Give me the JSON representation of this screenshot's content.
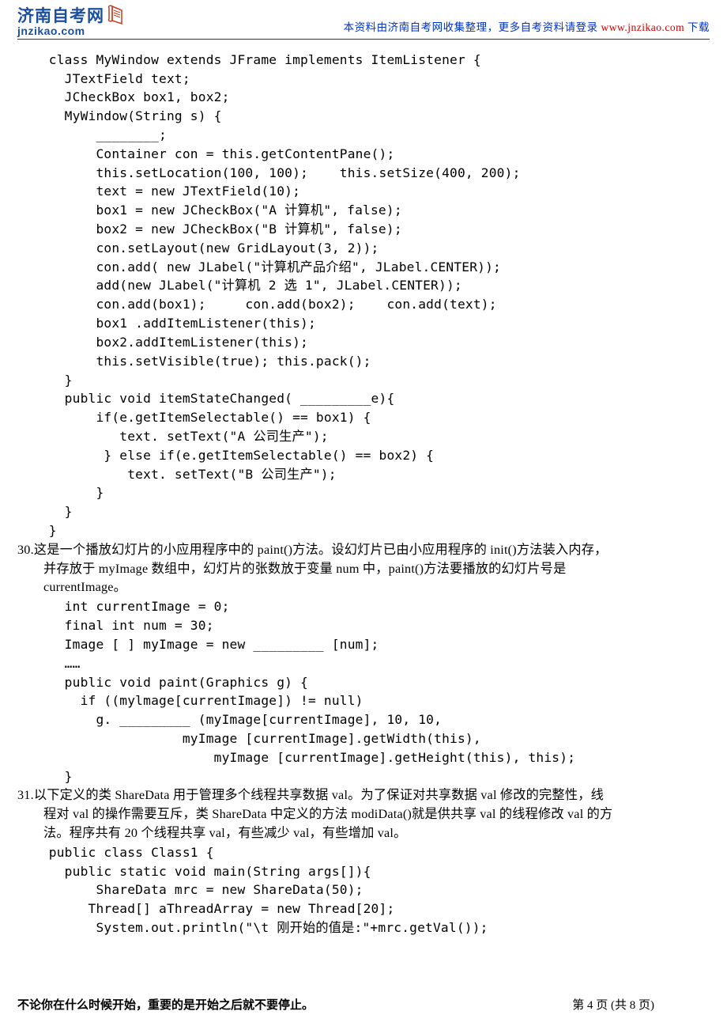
{
  "header": {
    "logo_cn": "济南自考网",
    "logo_en": "jnzikao.com",
    "tagline_prefix": "本资料由济南自考网收集整理，更多自考资料请登录 ",
    "tagline_url": "www.jnzikao.com",
    "tagline_suffix": " 下载"
  },
  "code29": "    class MyWindow extends JFrame implements ItemListener {\n      JTextField text;\n      JCheckBox box1, box2;\n      MyWindow(String s) {\n          ________;\n          Container con = this.getContentPane();\n          this.setLocation(100, 100);    this.setSize(400, 200);\n          text = new JTextField(10);\n          box1 = new JCheckBox(\"A 计算机\", false);\n          box2 = new JCheckBox(\"B 计算机\", false);\n          con.setLayout(new GridLayout(3, 2));\n          con.add( new JLabel(\"计算机产品介绍\", JLabel.CENTER));\n          add(new JLabel(\"计算机 2 选 1\", JLabel.CENTER));\n          con.add(box1);     con.add(box2);    con.add(text);\n          box1 .addItemListener(this);\n          box2.addItemListener(this);\n          this.setVisible(true); this.pack();\n      }\n      public void itemStateChanged( _________e){\n          if(e.getItemSelectable() == box1) {\n             text. setText(\"A 公司生产\");\n           } else if(e.getItemSelectable() == box2) {\n              text. setText(\"B 公司生产\");\n          }\n      }\n    }",
  "q30": {
    "line1": "30.这是一个播放幻灯片的小应用程序中的 paint()方法。设幻灯片已由小应用程序的 init()方法装入内存，",
    "line2": "并存放于 myImage 数组中，幻灯片的张数放于变量 num 中，paint()方法要播放的幻灯片号是",
    "line3": "currentImage。"
  },
  "code30": "      int currentImage = 0;\n      final int num = 30;\n      Image [ ] myImage = new _________ [num];\n      ……\n      public void paint(Graphics g) {\n        if ((mylmage[currentImage]) != null)\n          g. _________ (myImage[currentImage], 10, 10,\n                     myImage [currentImage].getWidth(this),\n                         myImage [currentImage].getHeight(this), this);\n      }",
  "q31": {
    "line1": "31.以下定义的类 ShareData 用于管理多个线程共享数据 val。为了保证对共享数据 val 修改的完整性，线",
    "line2": "程对 val 的操作需要互斥，类 ShareData 中定义的方法 modiData()就是供共享 val 的线程修改 val 的方",
    "line3": "法。程序共有 20 个线程共享 val，有些减少 val，有些增加 val。"
  },
  "code31": "    public class Class1 {\n      public static void main(String args[]){\n          ShareData mrc = new ShareData(50);\n         Thread[] aThreadArray = new Thread[20];\n          System.out.println(\"\\t 刚开始的值是:\"+mrc.getVal());",
  "footer": {
    "left": "不论你在什么时候开始，重要的是开始之后就不要停止。",
    "right": "第 4 页 (共 8 页)"
  }
}
